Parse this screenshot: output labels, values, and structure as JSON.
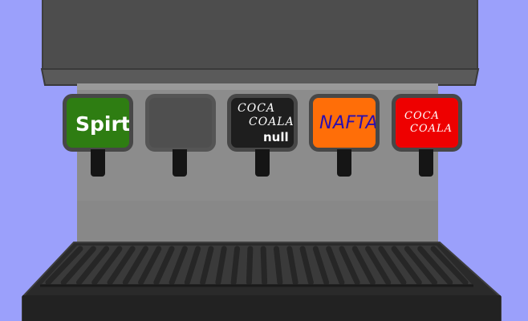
{
  "buttons": [
    {
      "id": "spirt",
      "lines": [
        "Spirt"
      ],
      "bg": "#2e7d12",
      "text_color": "#ffffff"
    },
    {
      "id": "empty",
      "lines": [],
      "bg": "#4f4f4f",
      "text_color": "#ffffff"
    },
    {
      "id": "coca-coala-null",
      "lines": [
        "COCA",
        "COALA",
        "null"
      ],
      "bg": "#1e1e1e",
      "text_color": "#ffffff"
    },
    {
      "id": "nafta",
      "lines": [
        "NAFTA"
      ],
      "bg": "#ff6e08",
      "text_color": "#2a0fb0"
    },
    {
      "id": "coca-coala",
      "lines": [
        "COCA",
        "COALA"
      ],
      "bg": "#ee0000",
      "text_color": "#ffffff"
    }
  ],
  "colors": {
    "background": "#9ba0fb",
    "machine_body": "#8c8c8c",
    "housing": "#4d4d4d",
    "nozzle": "#151515",
    "tray": "#2a2a2a"
  }
}
